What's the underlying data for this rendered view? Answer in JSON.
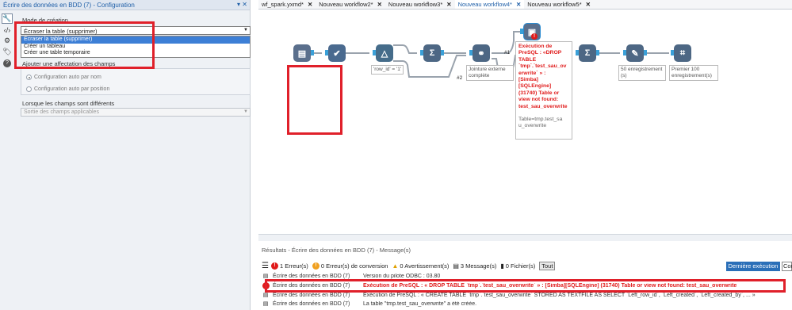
{
  "config_panel": {
    "title": "Écrire des données en BDD (7) - Configuration",
    "title_controls": "▾ ✕",
    "tools": [
      "wrench-icon",
      "code-icon",
      "gear-icon",
      "tag-icon",
      "help-icon"
    ],
    "mode_label": "Mode de création",
    "mode_value": "Écraser la table (supprimer)",
    "mode_options": [
      "Écraser la table (supprimer)",
      "Créer un tableau",
      "Créer une table temporaire"
    ],
    "field_map_title": "Ajouter une affectation des champs",
    "radio_by_name": "Configuration auto par nom",
    "radio_by_position": "Configuration auto par position",
    "diff_label": "Lorsque les champs sont différents",
    "diff_value": "Sortie des champs applicables"
  },
  "tabs": [
    {
      "label": "wf_spark.yxmd*",
      "active": false
    },
    {
      "label": "Nouveau workflow2*",
      "active": false
    },
    {
      "label": "Nouveau workflow3*",
      "active": false
    },
    {
      "label": "Nouveau workflow4*",
      "active": true
    },
    {
      "label": "Nouveau workflow5*",
      "active": false
    }
  ],
  "tab_close": "✕",
  "canvas": {
    "filter_caption": "'row_id' = '1'",
    "join_caption": "Jointure externe complète",
    "anchor_1": "#1",
    "anchor_2": "#2",
    "sample_caption": "50 enregistrement (s)",
    "browse_caption": "Premier 100 enregistrement(s)",
    "error_lines": [
      "Exécution de",
      "PreSQL : «DROP",
      "TABLE",
      "`tmp`.`test_sau_ov",
      "erwrite` » :",
      "[Simba]",
      "[SQLEngine]",
      "(31740) Table or",
      "view not found:",
      "test_sau_overwrite"
    ],
    "note_lines": [
      "Table=tmp.test_sa",
      "u_overwrite"
    ]
  },
  "results": {
    "title": "Résultats - Écrire des données en BDD (7) - Message(s)",
    "counts": {
      "errors": "1 Erreur(s)",
      "conversion": "0 Erreur(s) de conversion",
      "warnings": "0 Avertissement(s)",
      "messages": "3 Message(s)",
      "files": "0 Fichier(s)",
      "all": "Tout"
    },
    "last_run": "Dernière exécution",
    "con": "Con",
    "rows": [
      {
        "tool": "Écrire des données en BDD (7)",
        "message": "Version du pilote ODBC : 03.80",
        "type": "info"
      },
      {
        "tool": "Écrire des données en BDD (7)",
        "message": "Exécution de PreSQL : « DROP TABLE `tmp`.`test_sau_overwrite` » : [Simba][SQLEngine] (31740) Table or view not found: test_sau_overwrite",
        "type": "error"
      },
      {
        "tool": "Écrire des données en BDD (7)",
        "message": "Exécution de PreSQL : « CREATE TABLE `tmp`.`test_sau_overwrite` STORED AS TEXTFILE AS SELECT `Left_row_id`, `Left_created`, `Left_created_by`, ... »",
        "type": "info"
      },
      {
        "tool": "Écrire des données en BDD (7)",
        "message": "La table \"tmp.test_sau_overwrite\" a été créée.",
        "type": "info"
      }
    ]
  },
  "colors": {
    "accent": "#1f5fa8",
    "error": "#e01b1b",
    "highlight": "#e0202a"
  }
}
